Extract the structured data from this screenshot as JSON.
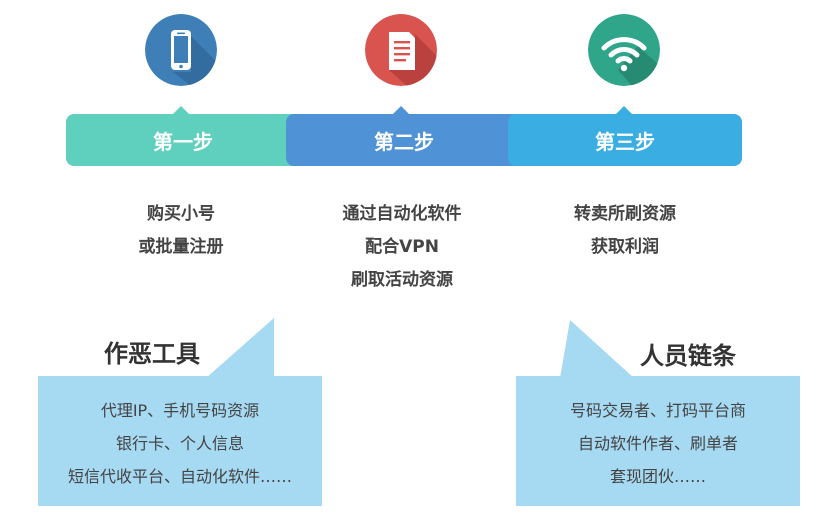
{
  "steps": [
    {
      "label": "第一步",
      "icon": "phone-icon",
      "color": "#5fcfbe",
      "lines": [
        "购买小号",
        "或批量注册"
      ]
    },
    {
      "label": "第二步",
      "icon": "document-icon",
      "color": "#4f92d5",
      "lines": [
        "通过自动化软件",
        "配合VPN",
        "刷取活动资源"
      ]
    },
    {
      "label": "第三步",
      "icon": "wifi-icon",
      "color": "#3aaee3",
      "lines": [
        "转卖所刷资源",
        "获取利润"
      ]
    }
  ],
  "icon_colors": {
    "phone": "#3f7fb7",
    "document": "#d9534f",
    "wifi": "#2fa58a"
  },
  "tools": {
    "title": "作恶工具",
    "lines": [
      "代理IP、手机号码资源",
      "银行卡、个人信息",
      "短信代收平台、自动化软件……"
    ]
  },
  "chain": {
    "title": "人员链条",
    "lines": [
      "号码交易者、打码平台商",
      "自动软件作者、刷单者",
      "套现团伙……"
    ]
  }
}
